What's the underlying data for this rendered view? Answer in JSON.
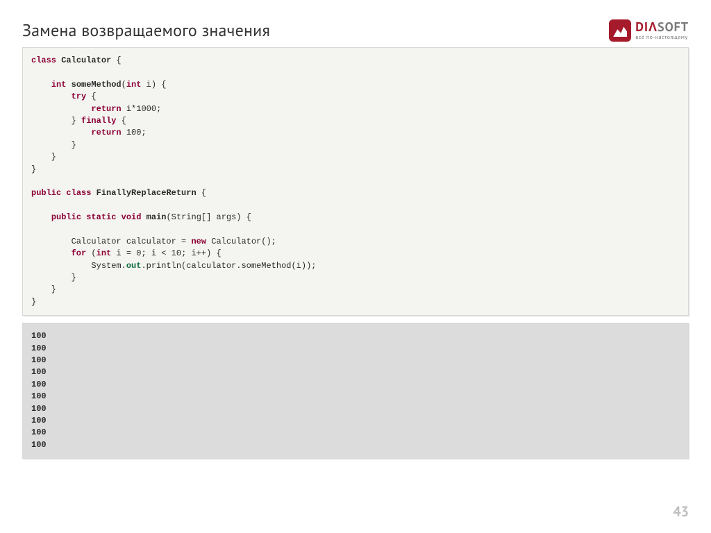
{
  "title": "Замена возвращаемого значения",
  "logo": {
    "brand_a": "DIΛ",
    "brand_b": "SOFT",
    "tagline": "всё по-настоящему"
  },
  "code": {
    "tok": [
      [
        "kw",
        "class"
      ],
      [
        "p",
        " "
      ],
      [
        "cls",
        "Calculator"
      ],
      [
        "p",
        " {"
      ],
      [
        "nl",
        ""
      ],
      [
        "nl",
        ""
      ],
      [
        "p",
        "    "
      ],
      [
        "type",
        "int"
      ],
      [
        "p",
        " "
      ],
      [
        "meth",
        "someMethod"
      ],
      [
        "p",
        "("
      ],
      [
        "type",
        "int"
      ],
      [
        "p",
        " i) {"
      ],
      [
        "nl",
        ""
      ],
      [
        "p",
        "        "
      ],
      [
        "kw",
        "try"
      ],
      [
        "p",
        " {"
      ],
      [
        "nl",
        ""
      ],
      [
        "p",
        "            "
      ],
      [
        "kw",
        "return"
      ],
      [
        "p",
        " i*"
      ],
      [
        "num",
        "1000"
      ],
      [
        "p",
        ";"
      ],
      [
        "nl",
        ""
      ],
      [
        "p",
        "        } "
      ],
      [
        "kw",
        "finally"
      ],
      [
        "p",
        " {"
      ],
      [
        "nl",
        ""
      ],
      [
        "p",
        "            "
      ],
      [
        "kw",
        "return"
      ],
      [
        "p",
        " "
      ],
      [
        "num",
        "100"
      ],
      [
        "p",
        ";"
      ],
      [
        "nl",
        ""
      ],
      [
        "p",
        "        }"
      ],
      [
        "nl",
        ""
      ],
      [
        "p",
        "    }"
      ],
      [
        "nl",
        ""
      ],
      [
        "p",
        "}"
      ],
      [
        "nl",
        ""
      ],
      [
        "nl",
        ""
      ],
      [
        "kw",
        "public"
      ],
      [
        "p",
        " "
      ],
      [
        "kw",
        "class"
      ],
      [
        "p",
        " "
      ],
      [
        "cls",
        "FinallyReplaceReturn"
      ],
      [
        "p",
        " {"
      ],
      [
        "nl",
        ""
      ],
      [
        "nl",
        ""
      ],
      [
        "p",
        "    "
      ],
      [
        "kw",
        "public"
      ],
      [
        "p",
        " "
      ],
      [
        "kw",
        "static"
      ],
      [
        "p",
        " "
      ],
      [
        "type",
        "void"
      ],
      [
        "p",
        " "
      ],
      [
        "meth",
        "main"
      ],
      [
        "p",
        "(String[] args) {"
      ],
      [
        "nl",
        ""
      ],
      [
        "nl",
        ""
      ],
      [
        "p",
        "        Calculator calculator = "
      ],
      [
        "kw",
        "new"
      ],
      [
        "p",
        " Calculator();"
      ],
      [
        "nl",
        ""
      ],
      [
        "p",
        "        "
      ],
      [
        "kw",
        "for"
      ],
      [
        "p",
        " ("
      ],
      [
        "type",
        "int"
      ],
      [
        "p",
        " i = "
      ],
      [
        "num",
        "0"
      ],
      [
        "p",
        "; i < "
      ],
      [
        "num",
        "10"
      ],
      [
        "p",
        "; i++) {"
      ],
      [
        "nl",
        ""
      ],
      [
        "p",
        "            System."
      ],
      [
        "field",
        "out"
      ],
      [
        "p",
        ".println(calculator.someMethod(i));"
      ],
      [
        "nl",
        ""
      ],
      [
        "p",
        "        }"
      ],
      [
        "nl",
        ""
      ],
      [
        "p",
        "    }"
      ],
      [
        "nl",
        ""
      ],
      [
        "p",
        "}"
      ]
    ]
  },
  "output_lines": [
    "100",
    "100",
    "100",
    "100",
    "100",
    "100",
    "100",
    "100",
    "100",
    "100"
  ],
  "page_number": "43"
}
